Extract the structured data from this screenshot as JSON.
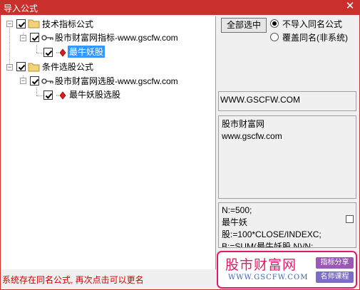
{
  "window": {
    "title": "导入公式",
    "close_glyph": "✕"
  },
  "tree": {
    "group1": {
      "label": "技术指标公式",
      "child": {
        "label": "股市财富网指标-www.gscfw.com",
        "leaf": "最牛妖股"
      }
    },
    "group2": {
      "label": "条件选股公式",
      "child": {
        "label": "股市财富网选股-www.gscfw.com",
        "leaf": "最牛妖股选股"
      }
    }
  },
  "options": {
    "select_all": "全部选中",
    "radio1": "不导入同名公式",
    "radio2": "覆盖同名(非系统)",
    "selected": "radio1"
  },
  "info": {
    "url": "WWW.GSCFW.COM",
    "desc_line1": "股市财富网",
    "desc_line2": "www.gscfw.com",
    "code_line1": "N:=500;",
    "code_line2": "最牛妖",
    "code_line3": "股:=100*CLOSE/INDEXC;",
    "code_line4": "B:=SUM(最牛妖股,N)/N;"
  },
  "status": "系统存在同名公式, 再次点击可以更名",
  "brand": {
    "name": "股市财富网",
    "url": "WWW.GSCFW.COM",
    "tag1": "指标分享",
    "tag2": "名师课程"
  },
  "colors": {
    "titlebar": "#c9302c",
    "selection": "#3399ff",
    "status": "#d00000",
    "brand": "#e01b6a"
  }
}
